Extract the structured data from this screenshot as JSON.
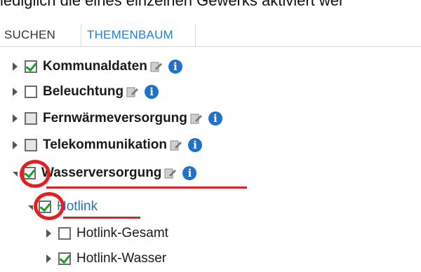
{
  "intro_text": "lediglich die eines einzelnen Gewerks aktiviert wer",
  "tabs": [
    {
      "label": "SUCHEN"
    },
    {
      "label": "THEMENBAUM"
    }
  ],
  "tree": {
    "items": [
      {
        "label": "Kommunaldaten",
        "state": "checked"
      },
      {
        "label": "Beleuchtung",
        "state": "unchecked"
      },
      {
        "label": "Fernwärmeversorgung",
        "state": "partial"
      },
      {
        "label": "Telekommunikation",
        "state": "partial"
      },
      {
        "label": "Wasserversorgung",
        "state": "checked"
      },
      {
        "label": "Hotlink",
        "state": "checked"
      },
      {
        "label": "Hotlink-Gesamt",
        "state": "unchecked"
      },
      {
        "label": "Hotlink-Wasser",
        "state": "checked"
      }
    ]
  },
  "colors": {
    "accent_blue": "#2a7bd3",
    "check_green": "#1e9b2d",
    "annotation_red": "#e51f1f",
    "info_blue": "#1f72c8"
  },
  "icons": {
    "edit": "edit-icon",
    "info": "info-icon"
  }
}
